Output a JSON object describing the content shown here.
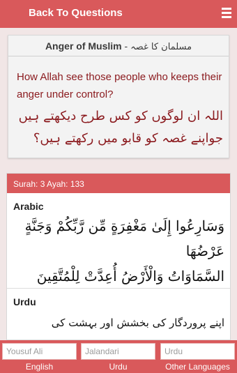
{
  "header": {
    "back_label": "Back To Questions",
    "menu_icon": "hamburger-menu-icon"
  },
  "question": {
    "title_en": "Anger of Muslim",
    "title_separator": " - ",
    "title_ur": "مسلمان کا غصہ",
    "text_en": "How Allah see those people who keeps their anger under control?",
    "text_ur_line1": "اللہ ان لوگوں کو کس طرح دیکھتے ہیں",
    "text_ur_line2": "جواپنے غصہ کو قابو میں رکھتے ہیں؟"
  },
  "ayah": {
    "reference": "Surah: 3 Ayah: 133",
    "arabic_label": "Arabic",
    "arabic_line1": "وَسَارِعُوا إِلَىٰ مَغْفِرَةٍ مِّن رَّبِّكُمْ وَجَنَّةٍ عَرْضُهَا",
    "arabic_line2": "السَّمَاوَاتُ وَالْأَرْضُ أُعِدَّتْ لِلْمُتَّقِينَ",
    "urdu_label": "Urdu",
    "urdu_text": "اپنے پروردگار کی بخشش اور بہشت کی"
  },
  "bottom_tabs": [
    {
      "value": "Yousuf Ali",
      "label": "English"
    },
    {
      "value": "Jalandari",
      "label": "Urdu"
    },
    {
      "value": "Urdu",
      "label": "Other Languages"
    }
  ],
  "colors": {
    "primary": "#d9595b",
    "question_text": "#8b1a1e",
    "background": "#f1e6e6"
  }
}
